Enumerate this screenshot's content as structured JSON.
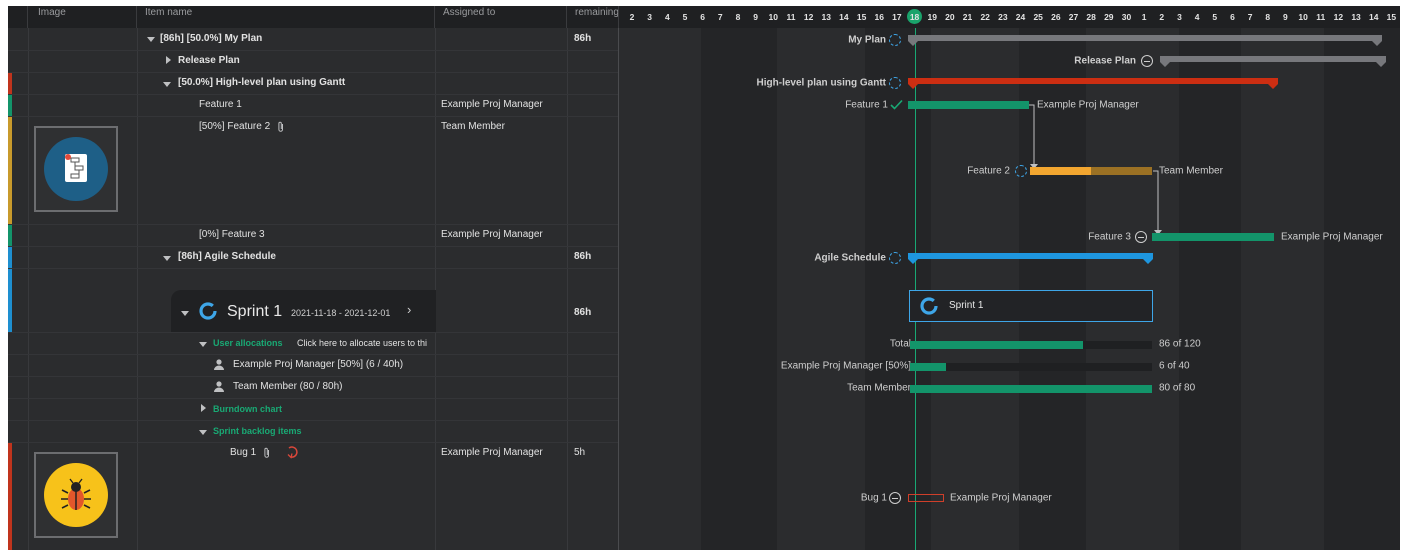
{
  "columns": {
    "image": "Image",
    "item_name": "Item name",
    "assigned_to": "Assigned to",
    "remaining": "remaining"
  },
  "timeline_days": [
    "2",
    "3",
    "4",
    "5",
    "6",
    "7",
    "8",
    "9",
    "10",
    "11",
    "12",
    "13",
    "14",
    "15",
    "16",
    "17",
    "18",
    "19",
    "20",
    "21",
    "22",
    "23",
    "24",
    "25",
    "26",
    "27",
    "28",
    "29",
    "30",
    "1",
    "2",
    "3",
    "4",
    "5",
    "6",
    "7",
    "8",
    "9",
    "10",
    "11",
    "12",
    "13",
    "14",
    "15"
  ],
  "today": "18",
  "rows": {
    "my_plan": {
      "name": "[86h] [50.0%] My Plan",
      "remaining": "86h"
    },
    "release_plan": {
      "name": "Release Plan"
    },
    "high_level": {
      "name": "[50.0%] High-level plan using Gantt"
    },
    "feature1": {
      "name": "Feature 1",
      "assigned": "Example Proj Manager"
    },
    "feature2": {
      "name": "[50%] Feature 2",
      "assigned": "Team Member"
    },
    "feature3": {
      "name": "[0%] Feature 3",
      "assigned": "Example Proj Manager"
    },
    "agile": {
      "name": "[86h] Agile Schedule",
      "remaining": "86h"
    },
    "sprint": {
      "name": "Sprint 1",
      "dates": "2021-11-18 - 2021-12-01",
      "remaining": "86h"
    },
    "user_alloc": {
      "name": "User allocations",
      "hint": "Click here to allocate users to thi"
    },
    "u_pm": {
      "name": "Example Proj Manager [50%] (6 / 40h)"
    },
    "u_tm": {
      "name": "Team Member (80 / 80h)"
    },
    "burndown": {
      "name": "Burndown chart"
    },
    "backlog": {
      "name": "Sprint backlog items"
    },
    "bug1": {
      "name": "Bug 1",
      "assigned": "Example Proj Manager",
      "remaining": "5h"
    }
  },
  "gantt": {
    "my_plan": "My Plan",
    "release_plan": "Release Plan",
    "high_level": "High-level plan using Gantt",
    "feature1": "Feature 1",
    "feature1_assignee": "Example Proj Manager",
    "feature2": "Feature 2",
    "feature2_assignee": "Team Member",
    "feature3": "Feature 3",
    "feature3_assignee": "Example Proj Manager",
    "agile": "Agile Schedule",
    "sprint": "Sprint 1",
    "alloc_total": "Total",
    "alloc_total_value": "86 of 120",
    "alloc_pm": "Example Proj Manager [50%]",
    "alloc_pm_value": "6 of 40",
    "alloc_tm": "Team Member",
    "alloc_tm_value": "80 of 80",
    "bug1": "Bug 1",
    "bug1_assignee": "Example Proj Manager"
  },
  "allocation_fill": {
    "total": 0.7167,
    "pm": 0.15,
    "tm": 1.0
  },
  "feature2_progress": 0.5,
  "colors": {
    "accent_green": "#19a974",
    "plan_gray": "#77787c",
    "high_level_red": "#cc2e12",
    "feature_green": "#13946a",
    "feature2_orange": "#f2a630",
    "agile_blue": "#1e96df",
    "bug_red": "#cf3f2a"
  }
}
